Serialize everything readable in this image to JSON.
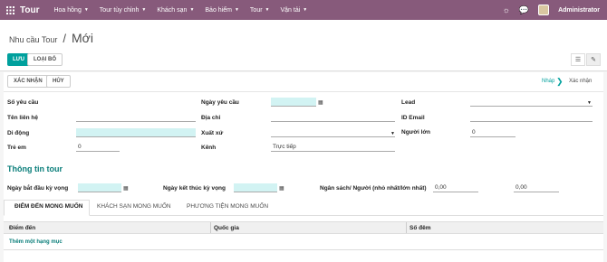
{
  "topbar": {
    "brand": "Tour",
    "menus": [
      "Hoa hồng",
      "Tour tùy chỉnh",
      "Khách sạn",
      "Bảo hiểm",
      "Tour",
      "Vận tải"
    ],
    "user": "Administrator",
    "bg_color": "#875a7b"
  },
  "breadcrumb": {
    "parent": "Nhu cầu Tour",
    "separator": "/",
    "current": "Mới"
  },
  "toolbar": {
    "save_label": "LƯU",
    "discard_label": "LOẠI BỎ"
  },
  "statusbar": {
    "confirm_label": "XÁC NHẬN",
    "cancel_label": "HỦY",
    "stages": [
      "Nháp",
      "Xác nhận"
    ],
    "active_stage": "Nháp"
  },
  "form": {
    "left": [
      {
        "label": "Số yêu cầu",
        "value": ""
      },
      {
        "label": "Tên liên hệ",
        "value": ""
      },
      {
        "label": "Di động",
        "value": ""
      },
      {
        "label": "Trẻ em",
        "value": "0"
      }
    ],
    "middle": [
      {
        "label": "Ngày yêu cầu",
        "value": ""
      },
      {
        "label": "Địa chỉ",
        "value": ""
      },
      {
        "label": "Xuất xứ",
        "value": ""
      },
      {
        "label": "Kênh",
        "value": "Trực tiếp"
      }
    ],
    "right": [
      {
        "label": "Lead",
        "value": ""
      },
      {
        "label": "ID Email",
        "value": ""
      },
      {
        "label": "Người lớn",
        "value": "0"
      }
    ]
  },
  "tour_info": {
    "title": "Thông tin tour",
    "start_label": "Ngày bắt đầu kỳ vọng",
    "start_value": "",
    "end_label": "Ngày kết thúc kỳ vọng",
    "end_value": "",
    "budget_label": "Ngân sách/ Người (nhỏ nhất/lớn nhất)",
    "budget_min": "0,00",
    "budget_max": "0,00"
  },
  "tabs": [
    "ĐIỂM ĐẾN MONG MUỐN",
    "KHÁCH SẠN MONG MUỐN",
    "PHƯƠNG TIỆN MONG MUỐN"
  ],
  "table": {
    "columns": [
      "Điểm đến",
      "Quốc gia",
      "Số đêm"
    ],
    "add_line": "Thêm một hạng mục"
  },
  "colors": {
    "accent": "#00a09d",
    "required_bg": "#d2f3f3"
  }
}
